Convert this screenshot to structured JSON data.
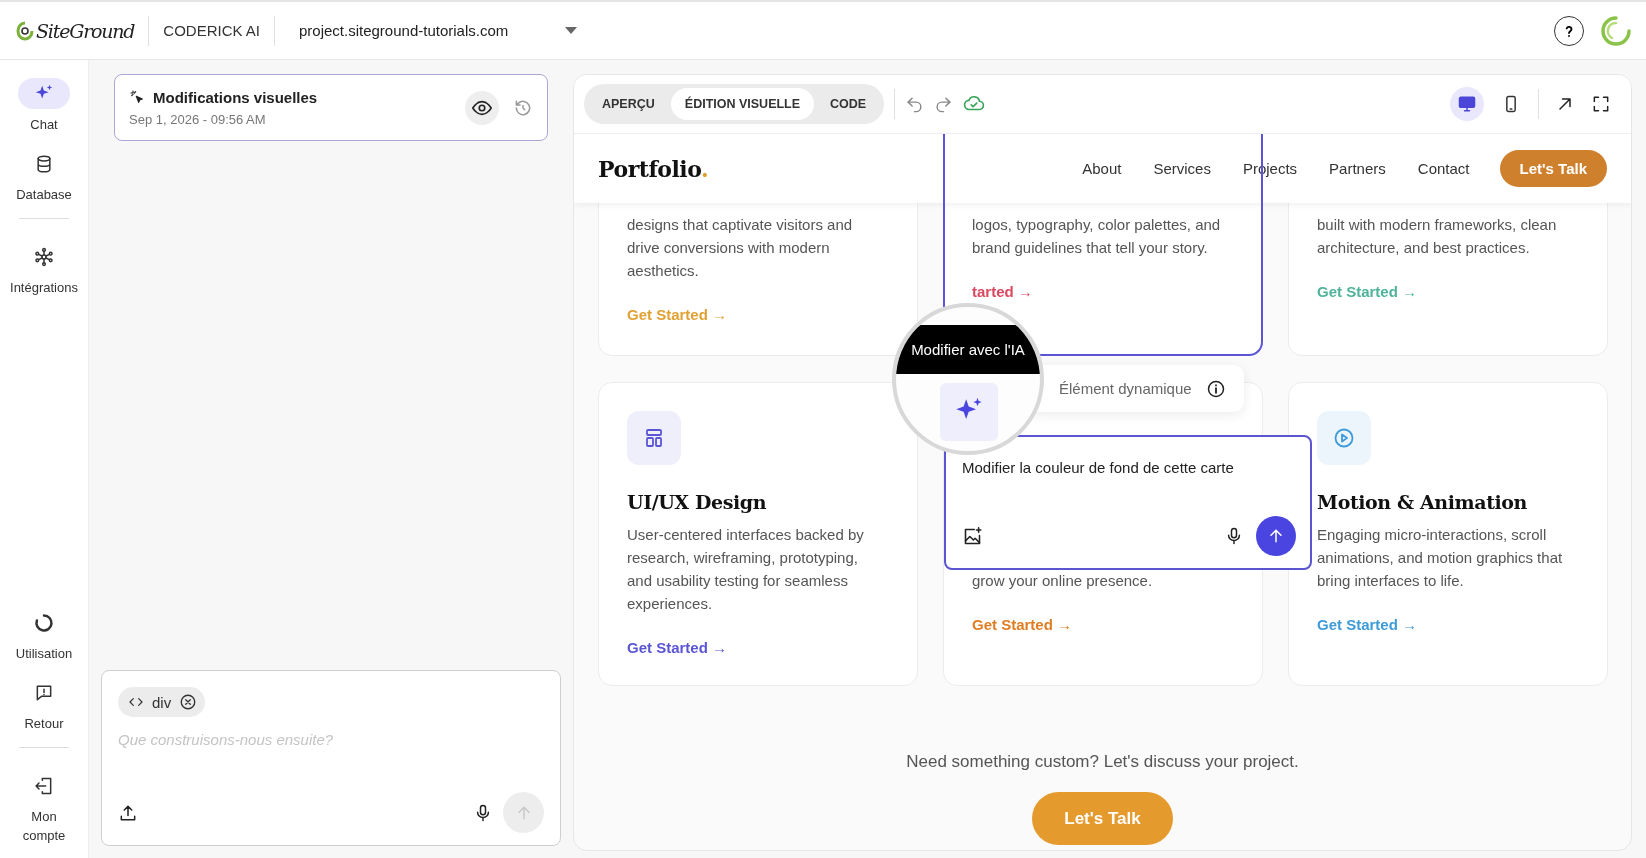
{
  "topbar": {
    "logo": "SiteGround",
    "product": "CODERICK AI",
    "project": "project.siteground-tutorials.com"
  },
  "sidebar": {
    "top": [
      {
        "label": "Chat",
        "selected": true
      },
      {
        "label": "Database",
        "selected": false
      },
      {
        "label": "Intégrations",
        "selected": false
      }
    ],
    "bottom": [
      {
        "label": "Utilisation",
        "selected": false
      },
      {
        "label": "Retour",
        "selected": false
      },
      {
        "label": "Mon compte",
        "selected": false
      }
    ]
  },
  "history": {
    "title": "Modifications visuelles",
    "date": "Sep 1, 2026 - 09:56 AM"
  },
  "composer": {
    "chip": "div",
    "placeholder": "Que construisons-nous ensuite?"
  },
  "preview": {
    "tabs": [
      {
        "label": "APERÇU",
        "selected": false
      },
      {
        "label": "ÉDITION VISUELLE",
        "selected": true
      },
      {
        "label": "CODE",
        "selected": false
      }
    ],
    "devices": [
      {
        "selected": true
      },
      {
        "selected": false
      }
    ]
  },
  "site": {
    "logo": "Portfolio",
    "logo_mark": ".",
    "nav": [
      "About",
      "Services",
      "Projects",
      "Partners",
      "Contact"
    ],
    "cta": "Let's Talk",
    "cards": [
      {
        "description": "designs that captivate visitors and drive conversions with modern aesthetics.",
        "link": "Get Started →",
        "color": "#e0a133",
        "selected": false
      },
      {
        "description": "logos, typography, color palettes, and brand guidelines that tell your story.",
        "link": "tarted →",
        "color": "#d9485f",
        "selected": true
      },
      {
        "description": "built with modern frameworks, clean architecture, and best practices.",
        "link": "Get Started →",
        "color": "#4fb39b",
        "selected": false
      },
      {
        "title": "UI/UX Design",
        "description": "User-centered interfaces backed by research, wireframing, prototyping, and usability testing for seamless experiences.",
        "link": "Get Started →",
        "color": "#5b55d6",
        "selected": false
      },
      {
        "description": "grow your online presence.",
        "link": "Get Started →",
        "color": "#e07d22",
        "selected": false
      },
      {
        "title": "Motion & Animation",
        "description": "Engaging micro-interactions, scroll animations, and motion graphics that bring interfaces to life.",
        "link": "Get Started →",
        "color": "#3d9bd9",
        "selected": false
      }
    ],
    "custom_text": "Need something custom? Let's discuss your project.",
    "custom_button": "Let's Talk"
  },
  "magnifier": {
    "tooltip": "Modifier avec l'IA"
  },
  "element_badge": {
    "label": "Élément dynamique"
  },
  "ai_prompt": {
    "value": "Modifier la couleur de fond de cette carte"
  }
}
